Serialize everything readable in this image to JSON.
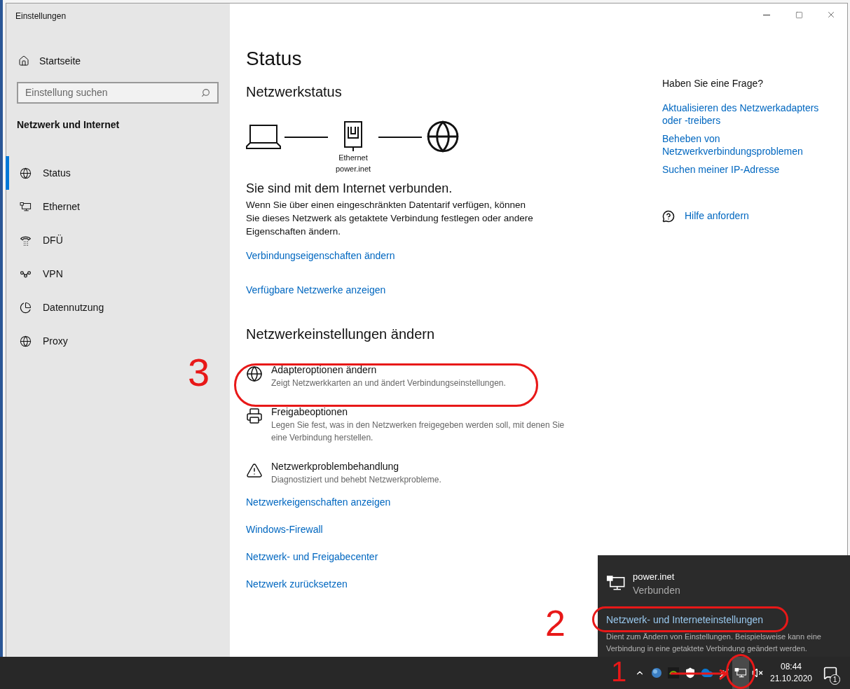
{
  "window": {
    "title": "Einstellungen"
  },
  "sidebar": {
    "home": "Startseite",
    "search": {
      "placeholder": "Einstellung suchen"
    },
    "section": "Netzwerk und Internet",
    "items": [
      {
        "label": "Status",
        "kind": "status",
        "selected": true
      },
      {
        "label": "Ethernet",
        "kind": "ethernet",
        "selected": false
      },
      {
        "label": "DFÜ",
        "kind": "dialup",
        "selected": false
      },
      {
        "label": "VPN",
        "kind": "vpn",
        "selected": false
      },
      {
        "label": "Datennutzung",
        "kind": "usage",
        "selected": false
      },
      {
        "label": "Proxy",
        "kind": "proxy",
        "selected": false
      }
    ]
  },
  "main": {
    "title": "Status",
    "network_status": {
      "heading": "Netzwerkstatus",
      "adapter": "Ethernet",
      "network": "power.inet"
    },
    "connection": {
      "headline": "Sie sind mit dem Internet verbunden.",
      "text": "Wenn Sie über einen eingeschränkten Datentarif verfügen, können Sie dieses Netzwerk als getaktete Verbindung festlegen oder andere Eigenschaften ändern.",
      "links": [
        "Verbindungseigenschaften ändern",
        "Verfügbare Netzwerke anzeigen"
      ]
    },
    "change": {
      "heading": "Netzwerkeinstellungen ändern",
      "options": [
        {
          "kind": "adapter",
          "title": "Adapteroptionen ändern",
          "description": "Zeigt Netzwerkkarten an und ändert Verbindungseinstellungen."
        },
        {
          "kind": "sharing",
          "title": "Freigabeoptionen",
          "description": "Legen Sie fest, was in den Netzwerken freigegeben werden soll, mit denen Sie eine Verbindung herstellen."
        },
        {
          "kind": "troubleshoot",
          "title": "Netzwerkproblembehandlung",
          "description": "Diagnostiziert und behebt Netzwerkprobleme."
        }
      ],
      "links": [
        "Netzwerkeigenschaften anzeigen",
        "Windows-Firewall",
        "Netzwerk- und Freigabecenter",
        "Netzwerk zurücksetzen"
      ]
    }
  },
  "help": {
    "heading": "Haben Sie eine Frage?",
    "links": [
      "Aktualisieren des Netzwerkadapters oder -treibers",
      "Beheben von Netzwerkverbindungsproblemen",
      "Suchen meiner IP-Adresse"
    ],
    "get_help": "Hilfe anfordern"
  },
  "flyout": {
    "network": "power.inet",
    "status": "Verbunden",
    "settings_link": "Netzwerk- und Interneteinstellungen",
    "description": "Dient zum Ändern von Einstellungen. Beispielsweise kann eine Verbindung in eine getaktete Verbindung geändert werden."
  },
  "taskbar": {
    "tray_icons": [
      {
        "kind": "chevron",
        "selected": false
      },
      {
        "kind": "browser",
        "selected": false
      },
      {
        "kind": "gpu",
        "selected": false
      },
      {
        "kind": "shield",
        "selected": false
      },
      {
        "kind": "cloud",
        "selected": false
      },
      {
        "kind": "device",
        "selected": false
      },
      {
        "kind": "network",
        "selected": true
      },
      {
        "kind": "speaker",
        "selected": false
      }
    ],
    "time": "08:44",
    "date": "21.10.2020",
    "notification_count": "1"
  },
  "annotations": [
    {
      "label": "3"
    },
    {
      "label": "2"
    },
    {
      "label": "1"
    }
  ]
}
